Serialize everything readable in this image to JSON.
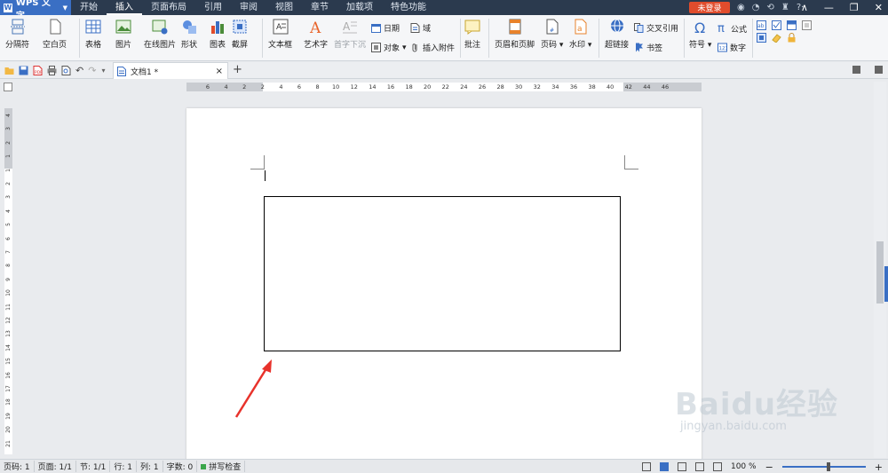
{
  "app": {
    "name": "WPS 文字",
    "login_label": "未登录"
  },
  "menu": {
    "tabs": [
      "开始",
      "插入",
      "页面布局",
      "引用",
      "审阅",
      "视图",
      "章节",
      "加载项",
      "特色功能"
    ],
    "active": "插入"
  },
  "ribbon": {
    "page_break": "分隔符",
    "blank_page": "空白页",
    "table": "表格",
    "picture": "图片",
    "online_picture": "在线图片",
    "shape": "形状",
    "chart": "图表",
    "screenshot": "截屏",
    "textbox": "文本框",
    "wordart": "艺术字",
    "drop_cap": "首字下沉",
    "date": "日期",
    "object": "对象",
    "field": "域",
    "attachment": "插入附件",
    "comment": "批注",
    "header_footer": "页眉和页脚",
    "page_number": "页码",
    "watermark": "水印",
    "hyperlink": "超链接",
    "cross_ref": "交叉引用",
    "bookmark": "书签",
    "symbol": "符号",
    "formula": "公式",
    "number": "数字"
  },
  "tabbar": {
    "doc_name": "文档1 *",
    "add": "+",
    "close": "×"
  },
  "ruler": {
    "h_labels": [
      "6",
      "4",
      "2",
      "2",
      "4",
      "6",
      "8",
      "10",
      "12",
      "14",
      "16",
      "18",
      "20",
      "22",
      "24",
      "26",
      "28",
      "30",
      "32",
      "34",
      "36",
      "38",
      "40",
      "42",
      "44",
      "46"
    ],
    "v_labels": [
      "4",
      "3",
      "2",
      "1",
      "1",
      "2",
      "3",
      "4",
      "5",
      "6",
      "7",
      "8",
      "9",
      "10",
      "11",
      "12",
      "13",
      "14",
      "15",
      "16",
      "17",
      "18",
      "19",
      "20",
      "21"
    ]
  },
  "status": {
    "page": "页码: 1",
    "pages": "页面: 1/1",
    "section": "节: 1/1",
    "row": "行: 1",
    "col": "列: 1",
    "word_count": "字数: 0",
    "spell_check": "拼写检查",
    "zoom": "100 %",
    "zoom_minus": "−",
    "zoom_plus": "+",
    "zoom_level_percent": 100
  },
  "watermark_text": {
    "brand": "Baidu经验",
    "url": "jingyan.baidu.com"
  },
  "colors": {
    "titlebar": "#2b3a4e",
    "accent": "#3a6fc4",
    "login": "#e04c2c",
    "arrow": "#e8322b"
  }
}
